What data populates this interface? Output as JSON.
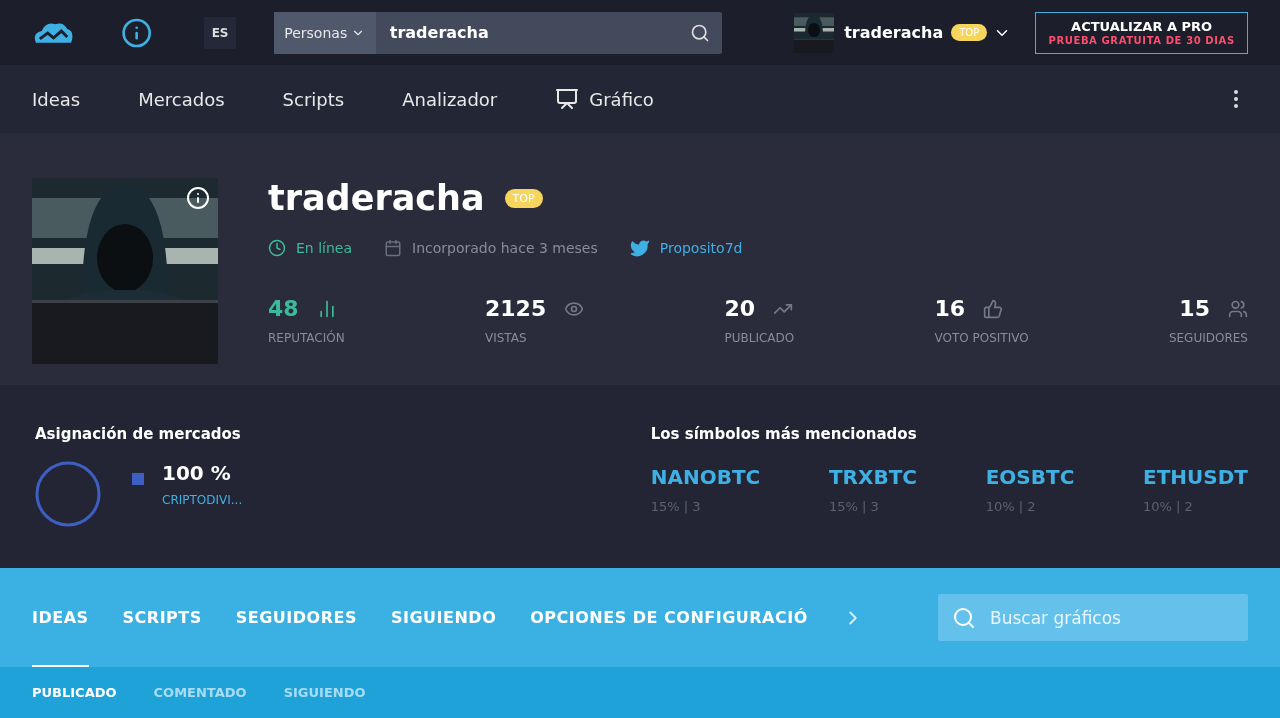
{
  "header": {
    "language": "ES",
    "search": {
      "scope": "Personas",
      "value": "traderacha"
    },
    "user": {
      "name": "traderacha",
      "badge": "TOP"
    },
    "upgrade": {
      "title": "ACTUALIZAR A PRO",
      "subtitle": "PRUEBA GRATUITA DE 30 DIAS"
    }
  },
  "nav": [
    {
      "label": "Ideas",
      "kind": "text"
    },
    {
      "label": "Mercados",
      "kind": "text"
    },
    {
      "label": "Scripts",
      "kind": "text"
    },
    {
      "label": "Analizador",
      "kind": "text"
    },
    {
      "label": "Gráfico",
      "kind": "chart"
    }
  ],
  "profile": {
    "name": "traderacha",
    "badge": "TOP",
    "status": "En línea",
    "joined": "Incorporado hace 3 meses",
    "twitter": "Proposito7d",
    "stats": [
      {
        "value": "48",
        "label": "REPUTACIÓN",
        "kind": "reputation"
      },
      {
        "value": "2125",
        "label": "VISTAS",
        "kind": "views"
      },
      {
        "value": "20",
        "label": "PUBLICADO",
        "kind": "published"
      },
      {
        "value": "16",
        "label": "VOTO POSITIVO",
        "kind": "likes"
      },
      {
        "value": "15",
        "label": "SEGUIDORES",
        "kind": "followers"
      }
    ]
  },
  "allocation": {
    "title": "Asignación de mercados",
    "items": [
      {
        "percent": "100 %",
        "name": "CRIPTODIVI...",
        "color": "#3d5fc4"
      }
    ]
  },
  "symbols": {
    "title": "Los símbolos más mencionados",
    "items": [
      {
        "symbol": "NANOBTC",
        "detail": "15% | 3"
      },
      {
        "symbol": "TRXBTC",
        "detail": "15% | 3"
      },
      {
        "symbol": "EOSBTC",
        "detail": "10% | 2"
      },
      {
        "symbol": "ETHUSDT",
        "detail": "10% | 2"
      }
    ]
  },
  "tabs": [
    {
      "label": "IDEAS",
      "selected": true
    },
    {
      "label": "SCRIPTS",
      "selected": false
    },
    {
      "label": "SEGUIDORES",
      "selected": false
    },
    {
      "label": "SIGUIENDO",
      "selected": false
    },
    {
      "label": "OPCIONES DE CONFIGURACIÓ",
      "selected": false
    }
  ],
  "tab_search": {
    "placeholder": "Buscar gráficos"
  },
  "subtabs": [
    {
      "label": "PUBLICADO",
      "selected": true
    },
    {
      "label": "COMENTADO",
      "selected": false
    },
    {
      "label": "SIGUIENDO",
      "selected": false
    }
  ]
}
